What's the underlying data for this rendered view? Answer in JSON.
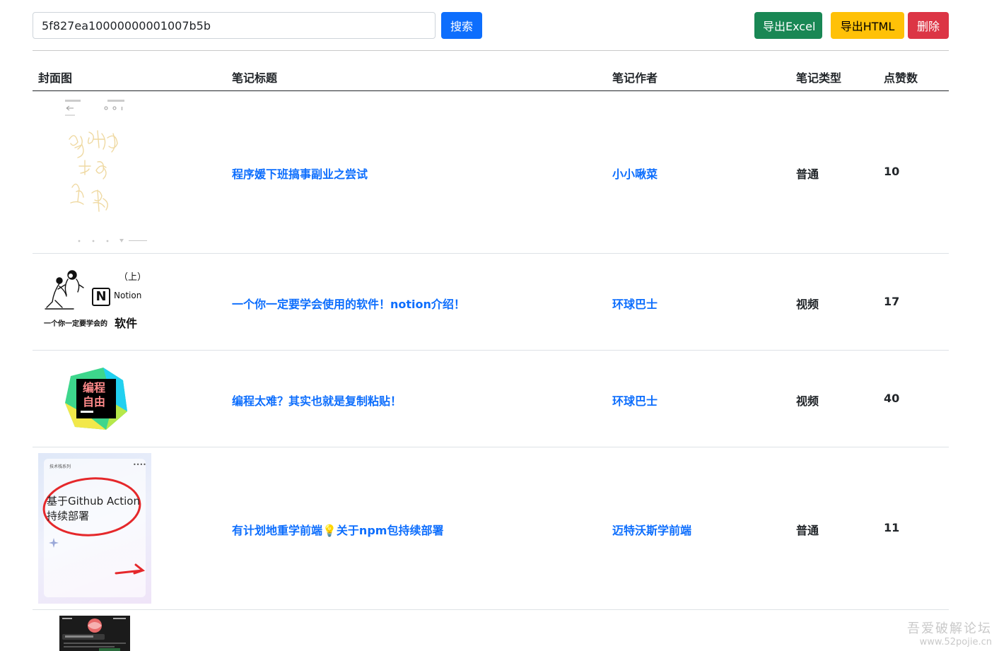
{
  "search": {
    "value": "5f827ea10000000001007b5b",
    "button_label": "搜索"
  },
  "actions": {
    "export_excel": "导出Excel",
    "export_html": "导出HTML",
    "delete": "删除"
  },
  "table": {
    "headers": {
      "cover": "封面图",
      "title": "笔记标题",
      "author": "笔记作者",
      "type": "笔记类型",
      "likes": "点赞数"
    },
    "rows": [
      {
        "title": "程序媛下班搞事副业之尝试",
        "author": "小小啾菜",
        "type": "普通",
        "likes": "10"
      },
      {
        "title": "一个你一定要学会使用的软件！notion介绍！",
        "author": "环球巴士",
        "type": "视频",
        "likes": "17"
      },
      {
        "title": "编程太难？其实也就是复制粘贴！",
        "author": "环球巴士",
        "type": "视频",
        "likes": "40"
      },
      {
        "title": "有计划地重学前端💡关于npm包持续部署",
        "author": "迈特沃斯学前端",
        "type": "普通",
        "likes": "11"
      }
    ]
  },
  "covers": {
    "row2": {
      "top": "（上）",
      "brand": "Notion",
      "caption_small": "一个你一定要学会的",
      "caption_big": "软件"
    },
    "row3": {
      "line1": "编程",
      "line2": "自由"
    },
    "row4": {
      "header": "技术栈系列",
      "line1": "基于Github Action",
      "line2": "持续部署"
    }
  },
  "watermark": {
    "line1": "吾爱破解论坛",
    "line2": "www.52pojie.cn"
  }
}
